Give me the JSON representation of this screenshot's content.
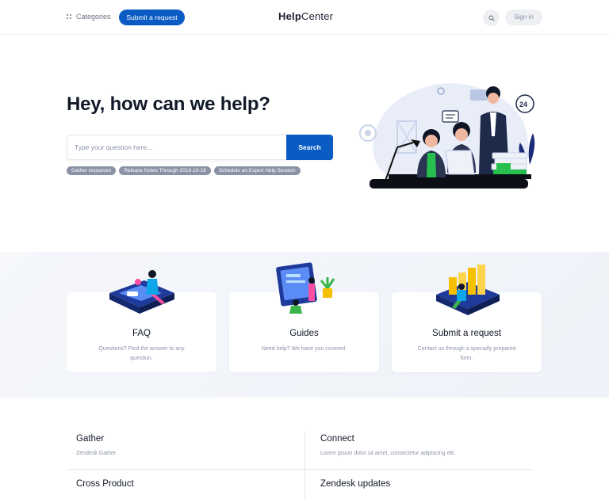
{
  "header": {
    "categories_label": "Categories",
    "submit_request_label": "Submit a request",
    "logo_bold": "Help",
    "logo_light": "Center",
    "sign_in_label": "Sign in"
  },
  "hero": {
    "title": "Hey, how can we help?",
    "search_placeholder": "Type your question here...",
    "search_button": "Search",
    "tags": [
      "Gather resources",
      "Release Notes Through 2019-10-18",
      "Schedule an Expert Help Session"
    ]
  },
  "cards": [
    {
      "title": "FAQ",
      "description": "Questions? Find the answer to any question."
    },
    {
      "title": "Guides",
      "description": "Need help? We have you covered."
    },
    {
      "title": "Submit a request",
      "description": "Contact us through a specially prepared form."
    }
  ],
  "sections": [
    {
      "title": "Gather",
      "description": "Zendesk Gather"
    },
    {
      "title": "Connect",
      "description": "Lorem ipsum dolor sit amet, consectetur adipiscing elit."
    },
    {
      "title": "Cross Product",
      "description": ""
    },
    {
      "title": "Zendesk updates",
      "description": ""
    }
  ],
  "colors": {
    "accent": "#0a5cc4",
    "text_muted": "#8a93a6",
    "tag_bg": "#8a93a6",
    "band_bg": "#f2f5fa"
  },
  "icons": [
    "categories-grid-icon",
    "search-icon"
  ]
}
